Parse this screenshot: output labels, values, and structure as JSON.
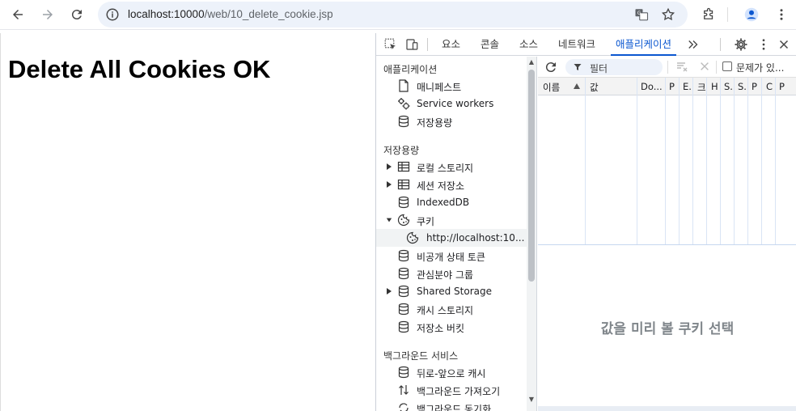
{
  "browser": {
    "url_host": "localhost:10000",
    "url_path": "/web/10_delete_cookie.jsp"
  },
  "page": {
    "heading": "Delete All Cookies OK"
  },
  "devtools": {
    "tabs": [
      "요소",
      "콘솔",
      "소스",
      "네트워크",
      "애플리케이션"
    ],
    "active_tab": "애플리케이션",
    "sidebar": {
      "section_application": "애플리케이션",
      "app_items": [
        "매니페스트",
        "Service workers",
        "저장용량"
      ],
      "section_storage": "저장용량",
      "storage_items": [
        "로컬 스토리지",
        "세션 저장소",
        "IndexedDB",
        "쿠키",
        "http://localhost:10...",
        "비공개 상태 토큰",
        "관심분야 그룹",
        "Shared Storage",
        "캐시 스토리지",
        "저장소 버킷"
      ],
      "section_background": "백그라운드 서비스",
      "background_items": [
        "뒤로-앞으로 캐시",
        "백그라운드 가져오기",
        "백그라운드 동기화"
      ]
    },
    "filter_placeholder": "필터",
    "issues_checkbox_label": "문제가 있...",
    "columns": [
      "이름",
      "값",
      "Do...",
      "P",
      "E.",
      "크",
      "H",
      "S.",
      "S.",
      "P",
      "C",
      "P"
    ],
    "preview_placeholder": "값을 미리 볼 쿠키 선택"
  }
}
